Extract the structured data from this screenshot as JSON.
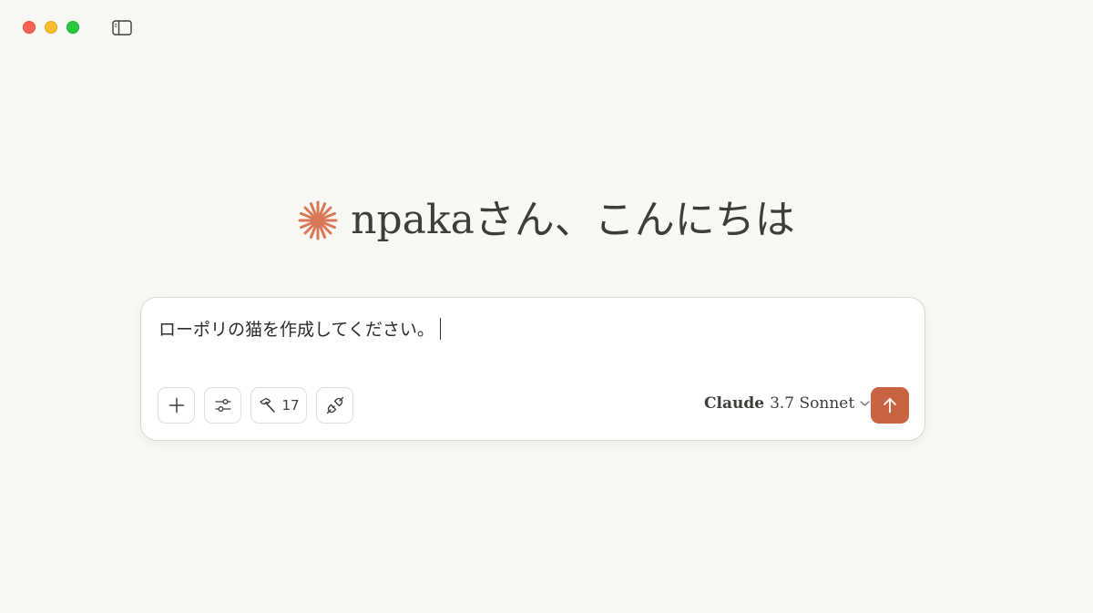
{
  "window": {
    "controls": [
      "close",
      "minimize",
      "zoom"
    ],
    "sidebar_toggle_icon": "sidebar-icon"
  },
  "greeting": {
    "icon": "claude-spark-icon",
    "text": "npakaさん、こんにちは"
  },
  "composer": {
    "input_text": "ローポリの猫を作成してください。",
    "buttons": {
      "add_icon": "plus-icon",
      "settings_icon": "sliders-icon",
      "tools_icon": "hammer-icon",
      "tools_count": "17",
      "integrations_icon": "plug-icon"
    },
    "model": {
      "name": "Claude",
      "version": "3.7 Sonnet",
      "dropdown_icon": "chevron-down-icon"
    },
    "send_icon": "arrow-up-icon"
  },
  "colors": {
    "background": "#f9f8f4",
    "accent": "#c96442",
    "spark": "#d97757"
  }
}
